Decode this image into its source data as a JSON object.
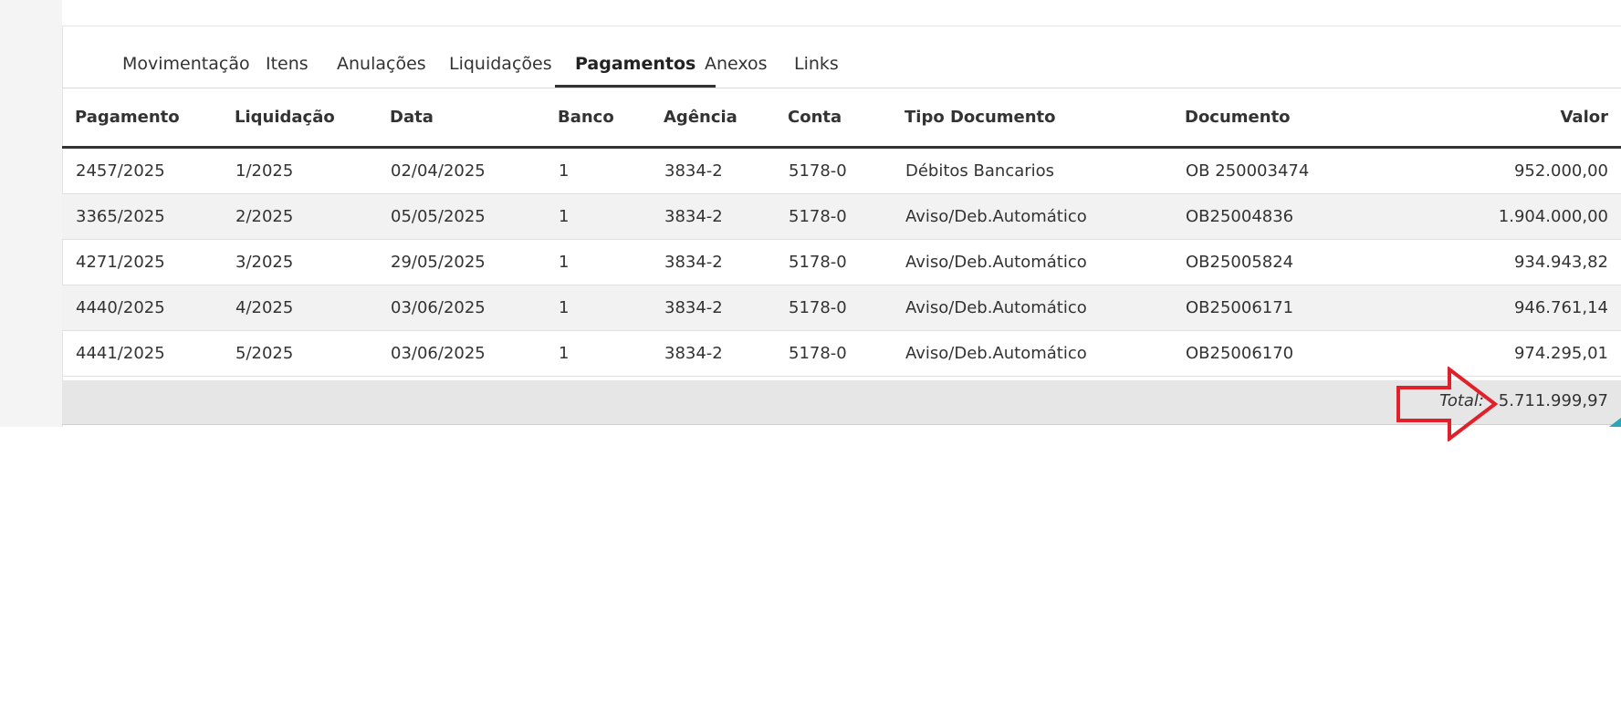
{
  "tabs": [
    {
      "label": "Movimentação"
    },
    {
      "label": "Itens"
    },
    {
      "label": "Anulações"
    },
    {
      "label": "Liquidações"
    },
    {
      "label": "Pagamentos"
    },
    {
      "label": "Anexos"
    },
    {
      "label": "Links"
    }
  ],
  "active_tab": "Pagamentos",
  "table": {
    "headers": [
      "Pagamento",
      "Liquidação",
      "Data",
      "Banco",
      "Agência",
      "Conta",
      "Tipo Documento",
      "Documento",
      "Valor"
    ],
    "rows": [
      [
        "2457/2025",
        "1/2025",
        "02/04/2025",
        "1",
        "3834-2",
        "5178-0",
        "Débitos Bancarios",
        "OB 250003474",
        "952.000,00"
      ],
      [
        "3365/2025",
        "2/2025",
        "05/05/2025",
        "1",
        "3834-2",
        "5178-0",
        "Aviso/Deb.Automático",
        "OB25004836",
        "1.904.000,00"
      ],
      [
        "4271/2025",
        "3/2025",
        "29/05/2025",
        "1",
        "3834-2",
        "5178-0",
        "Aviso/Deb.Automático",
        "OB25005824",
        "934.943,82"
      ],
      [
        "4440/2025",
        "4/2025",
        "03/06/2025",
        "1",
        "3834-2",
        "5178-0",
        "Aviso/Deb.Automático",
        "OB25006171",
        "946.761,14"
      ],
      [
        "4441/2025",
        "5/2025",
        "03/06/2025",
        "1",
        "3834-2",
        "5178-0",
        "Aviso/Deb.Automático",
        "OB25006170",
        "974.295,01"
      ]
    ]
  },
  "total": {
    "label": "Total:",
    "value": "5.711.999,97"
  },
  "colors": {
    "annotation_arrow": "#e0202a",
    "accent_corner": "#2aa6b8",
    "row_alt": "#f2f2f2",
    "total_bg": "#e6e6e6"
  },
  "icons": {
    "annotation": "red-arrow-icon"
  }
}
